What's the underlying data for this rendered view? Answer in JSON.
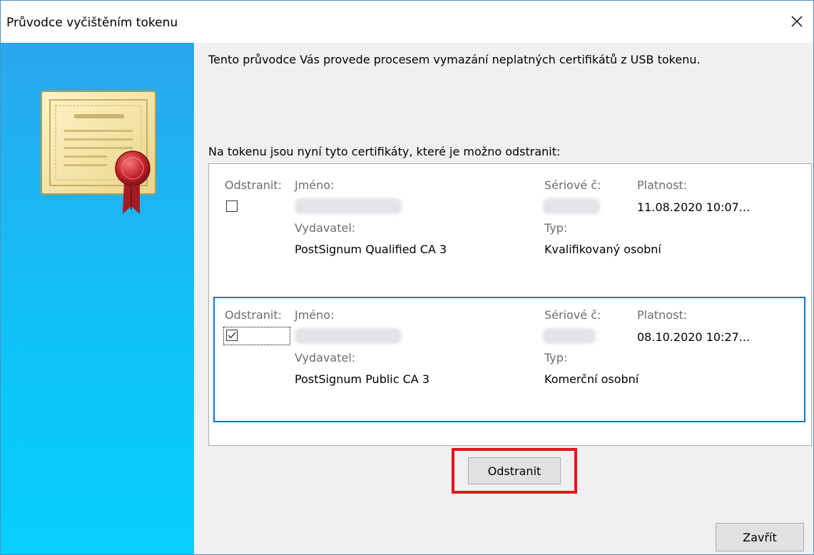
{
  "window": {
    "title": "Průvodce vyčištěním tokenu",
    "close_icon": "close-icon"
  },
  "intro_text": "Tento průvodce Vás provede procesem vymazání neplatných certifikátů z USB tokenu.",
  "list_caption": "Na tokenu jsou nyní tyto certifikáty, které je možno odstranit:",
  "certificates": [
    {
      "remove_label": "Odstranit:",
      "name_label": "Jméno:",
      "serial_label": "Sériové č:",
      "validity_label": "Platnost:",
      "validity_value": "11.08.2020 10:07...",
      "issuer_label": "Vydavatel:",
      "issuer_value": "PostSignum Qualified CA 3",
      "type_label": "Typ:",
      "type_value": "Kvalifikovaný osobní",
      "checked": false,
      "selected": false
    },
    {
      "remove_label": "Odstranit:",
      "name_label": "Jméno:",
      "serial_label": "Sériové č:",
      "validity_label": "Platnost:",
      "validity_value": "08.10.2020 10:27...",
      "issuer_label": "Vydavatel:",
      "issuer_value": "PostSignum Public CA 3",
      "type_label": "Typ:",
      "type_value": "Komerční osobní",
      "checked": true,
      "selected": true
    }
  ],
  "buttons": {
    "remove": "Odstranit",
    "close": "Zavřít"
  },
  "colors": {
    "selection_border": "#0a76d0",
    "highlight": "#e8111c",
    "left_pane_top": "#2aa7ee",
    "left_pane_bottom": "#07cffb"
  },
  "icons": {
    "certificate": "certificate-icon",
    "checkmark": "checkmark-icon"
  }
}
